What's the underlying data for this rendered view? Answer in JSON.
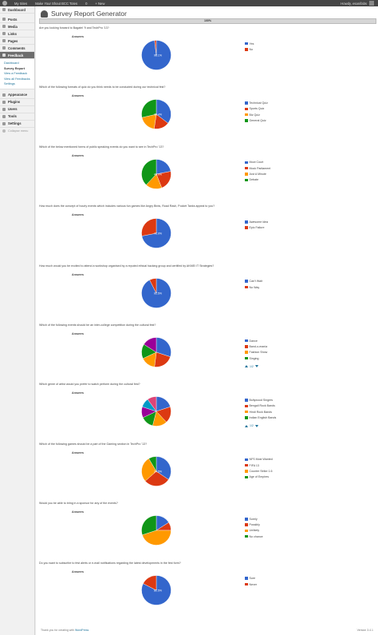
{
  "adminbar": {
    "site": "My Sites",
    "site_name": "Make Your Shout BCC Totes",
    "comments": "0",
    "new": "+  New",
    "howdy": "Howdy, esanifabs"
  },
  "sidebar": {
    "items_top": [
      {
        "label": "Dashboard",
        "icon": "dashboard-icon"
      }
    ],
    "items_mid": [
      {
        "label": "Posts",
        "icon": "posts-icon"
      },
      {
        "label": "Media",
        "icon": "media-icon"
      },
      {
        "label": "Links",
        "icon": "links-icon"
      },
      {
        "label": "Pages",
        "icon": "pages-icon"
      },
      {
        "label": "Comments",
        "icon": "comments-icon"
      }
    ],
    "feedback": {
      "label": "Feedback",
      "icon": "feedback-icon"
    },
    "submenu": [
      "Dashboard",
      "Survey Report",
      "View a Feedback",
      "View all Feedbacks",
      "Settings"
    ],
    "items_bottom": [
      {
        "label": "Appearance",
        "icon": "appearance-icon"
      },
      {
        "label": "Plugins",
        "icon": "plugins-icon"
      },
      {
        "label": "Users",
        "icon": "users-icon"
      },
      {
        "label": "Tools",
        "icon": "tools-icon"
      },
      {
        "label": "Settings",
        "icon": "settings-icon"
      }
    ],
    "collapse": "Collapse menu"
  },
  "page": {
    "title": "Survey Report Generator",
    "progress": "100%",
    "progress_value": 1.0
  },
  "answers_label": "Answers",
  "questions": [
    {
      "question": "Are you looking forward to Bagatel ’9 and TechPro ’13?",
      "slices": [
        {
          "label": "Yes",
          "value": 98.1,
          "color": "#3366cc"
        },
        {
          "label": "No",
          "value": 1.9,
          "color": "#dc3912"
        }
      ],
      "center_label": "98.1%"
    },
    {
      "question": "Which of the following formats of quiz do you think needs to be conducted during our technical fest?",
      "slices": [
        {
          "label": "Technical Quiz",
          "value": 35.4,
          "color": "#3366cc"
        },
        {
          "label": "Sports Quiz",
          "value": 17,
          "color": "#dc3912"
        },
        {
          "label": "Biz Quiz",
          "value": 19,
          "color": "#ff9900"
        },
        {
          "label": "General Quiz",
          "value": 28.6,
          "color": "#109618"
        }
      ],
      "center_label": "35.4%"
    },
    {
      "question": "Which of the below mentioned forms of public speaking events do you want to see in TechPro ’13?",
      "slices": [
        {
          "label": "Moot Court",
          "value": 22,
          "color": "#3366cc"
        },
        {
          "label": "Mock Parliament",
          "value": 22,
          "color": "#dc3912"
        },
        {
          "label": "Just A Minute",
          "value": 18,
          "color": "#ff9900"
        },
        {
          "label": "Debate",
          "value": 38,
          "color": "#109618"
        }
      ],
      "center_label": "40.0%"
    },
    {
      "question": "How much does the concept of hourly events which includes various fun games like Angry Birds, Road Rash, Pocket Tanks appeal to you?",
      "slices": [
        {
          "label": "Awesome idea",
          "value": 72,
          "color": "#3366cc"
        },
        {
          "label": "Epic Failure",
          "value": 28,
          "color": "#dc3912"
        }
      ],
      "center_label": "72.0%"
    },
    {
      "question": "How much would you be excited to attend a workshop organised by a reputed ethical hacking group and certified by AKMEI IT Strategies?",
      "slices": [
        {
          "label": "Can’t Wait",
          "value": 92.5,
          "color": "#3366cc"
        },
        {
          "label": "No Way",
          "value": 7.5,
          "color": "#dc3912"
        }
      ],
      "center_label": "92.5%"
    },
    {
      "question": "Which of the following events should be an inter-college competition during the cultural fest?",
      "slices": [
        {
          "label": "Dance",
          "value": 30,
          "color": "#3366cc"
        },
        {
          "label": "Band-o-mania",
          "value": 22,
          "color": "#dc3912"
        },
        {
          "label": "Fashion Show",
          "value": 16,
          "color": "#ff9900"
        },
        {
          "label": "Singing",
          "value": 16,
          "color": "#109618"
        },
        {
          "label": "",
          "value": 16,
          "color": "#990099"
        }
      ],
      "center_label": "",
      "pager": "1/2"
    },
    {
      "question": "Which genre of artist would you prefer to watch perform during the cultural fest?",
      "slices": [
        {
          "label": "Bollywood Singers",
          "value": 20,
          "color": "#3366cc"
        },
        {
          "label": "Bengali Rock Bands",
          "value": 18,
          "color": "#dc3912"
        },
        {
          "label": "Hindi Rock Bands",
          "value": 16,
          "color": "#ff9900"
        },
        {
          "label": "Indian English Bands",
          "value": 14,
          "color": "#109618"
        },
        {
          "label": "",
          "value": 12,
          "color": "#990099"
        },
        {
          "label": "",
          "value": 10,
          "color": "#0099c6"
        },
        {
          "label": "",
          "value": 10,
          "color": "#dd4477"
        }
      ],
      "center_label": "",
      "pager": "1/2"
    },
    {
      "question": "Which of the following games should be a part of the Gaming section in TechPro ’13?",
      "slices": [
        {
          "label": "NFS Most Wanted",
          "value": 34.5,
          "color": "#3366cc"
        },
        {
          "label": "FIFA 13",
          "value": 29,
          "color": "#dc3912"
        },
        {
          "label": "Counter Strike 1.6",
          "value": 28,
          "color": "#ff9900"
        },
        {
          "label": "Age of Empires",
          "value": 8.5,
          "color": "#109618"
        }
      ],
      "center_label": "34.5%"
    },
    {
      "question": "Would you be able to bring in a sponsor for any of the events?",
      "slices": [
        {
          "label": "Surely",
          "value": 16,
          "color": "#3366cc"
        },
        {
          "label": "Possibly",
          "value": 9,
          "color": "#dc3912"
        },
        {
          "label": "Unlikely",
          "value": 45,
          "color": "#ff9900"
        },
        {
          "label": "No chance",
          "value": 30,
          "color": "#109618"
        }
      ],
      "center_label": ""
    },
    {
      "question": "Do you want to subscribe to fest alerts or e-mail notifications regarding the latest developments in the fest form?",
      "slices": [
        {
          "label": "Sure",
          "value": 82.5,
          "color": "#3366cc"
        },
        {
          "label": "Never",
          "value": 17.5,
          "color": "#dc3912"
        }
      ],
      "center_label": "82.5%"
    }
  ],
  "footer": {
    "thanks": "Thank you for creating with ",
    "wp": "WordPress",
    "version": "Version 3.4.1"
  }
}
